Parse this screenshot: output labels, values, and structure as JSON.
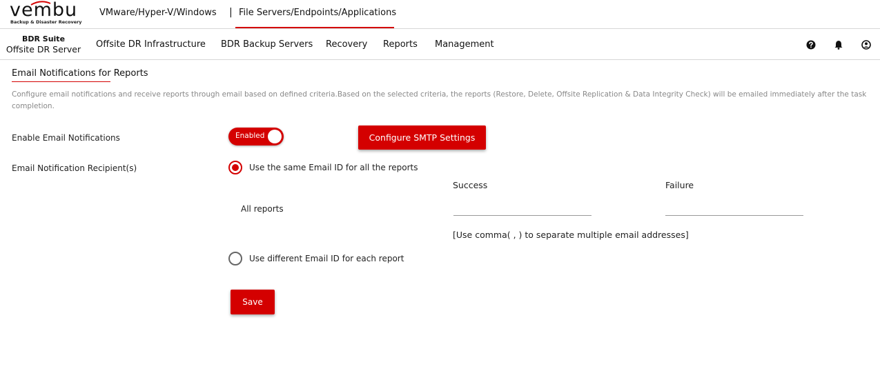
{
  "brand": {
    "logo_text": "vembu",
    "tagline": "Backup & Disaster Recovery"
  },
  "top_tabs": [
    {
      "label": "VMware/Hyper-V/Windows",
      "active": false
    },
    {
      "label": "File Servers/Endpoints/Applications",
      "active": true
    }
  ],
  "top_separator": "|",
  "product": {
    "name": "BDR Suite",
    "sub": "Offsite DR Server"
  },
  "nav": {
    "items": [
      {
        "label": "Offsite DR Infrastructure"
      },
      {
        "label": "BDR Backup Servers"
      },
      {
        "label": "Recovery"
      },
      {
        "label": "Reports"
      },
      {
        "label": "Management"
      }
    ],
    "icons": [
      "help-icon",
      "bell-icon",
      "user-icon"
    ]
  },
  "page": {
    "title": "Email Notifications for Reports",
    "description": "Configure email notifications and receive reports through email based on defined criteria.Based on the selected criteria, the reports (Restore, Delete, Offsite Replication & Data Integrity Check) will be emailed immediately after the task completion."
  },
  "form": {
    "enable_label": "Enable Email Notifications",
    "toggle_text": "Enabled",
    "toggle_on": true,
    "smtp_button": "Configure SMTP Settings",
    "recipient_label": "Email Notification Recipient(s)",
    "option_same": "Use the same Email ID for all the reports",
    "option_same_checked": true,
    "col_success": "Success",
    "col_failure": "Failure",
    "row_label": "All reports",
    "success_value": "",
    "failure_value": "",
    "hint": "[Use comma( , ) to separate multiple email addresses]",
    "option_different": "Use different Email ID for each report",
    "option_different_checked": false,
    "save_button": "Save"
  },
  "colors": {
    "accent": "#d40000",
    "muted_text": "#888888"
  }
}
